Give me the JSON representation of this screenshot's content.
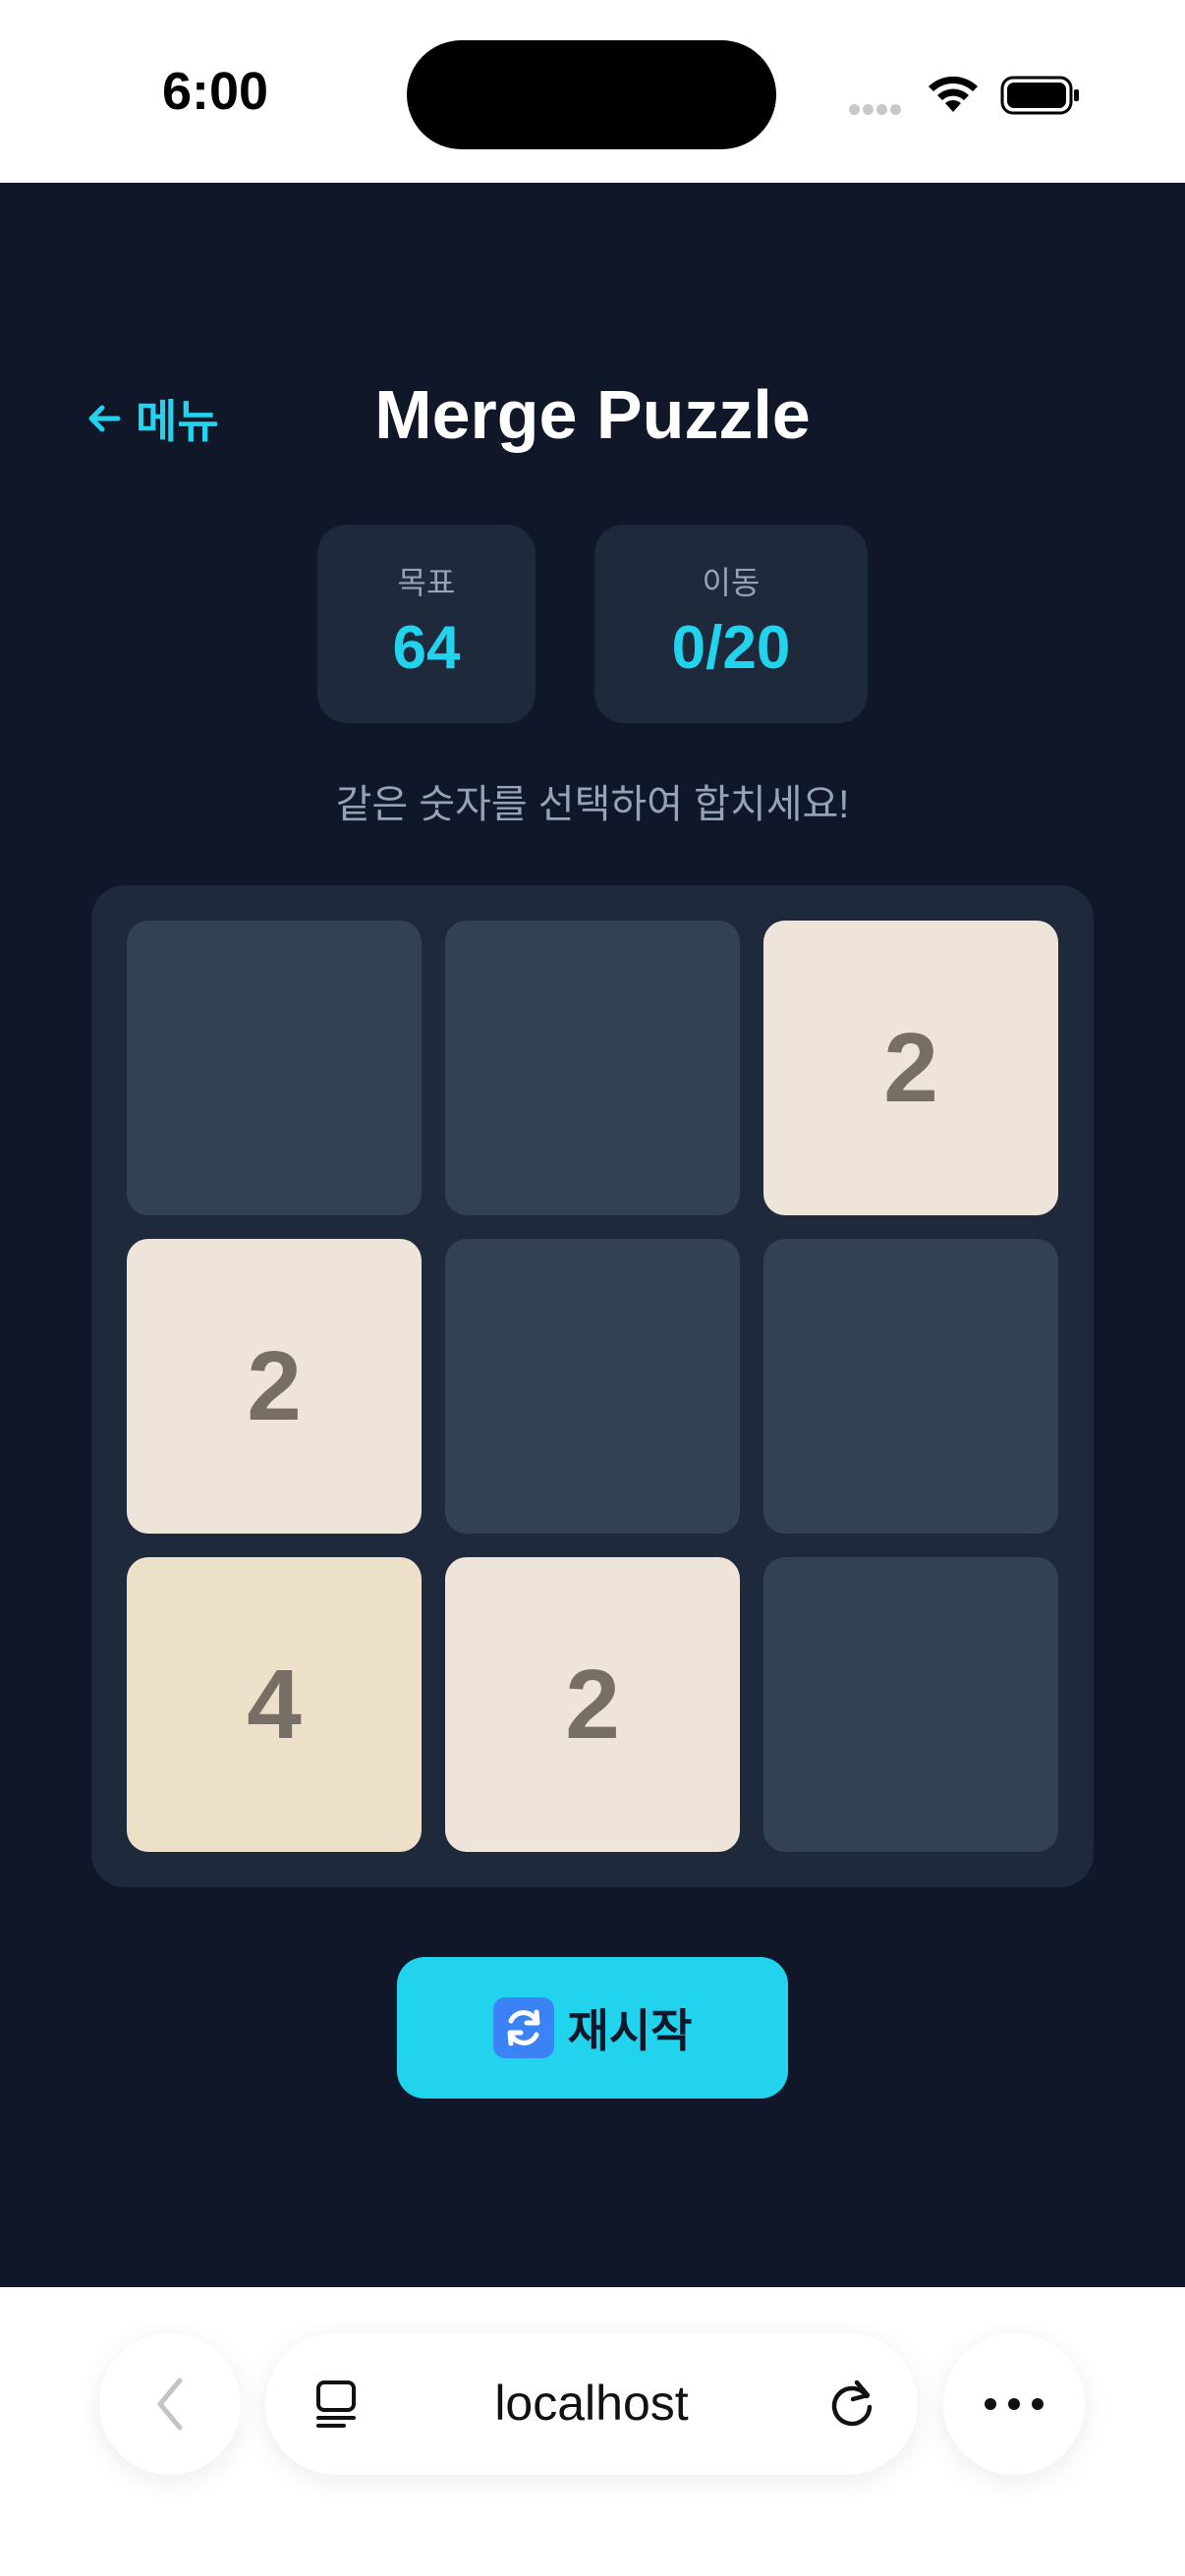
{
  "status_bar": {
    "time": "6:00"
  },
  "header": {
    "back_label": "메뉴",
    "title": "Merge Puzzle"
  },
  "stats": {
    "target_label": "목표",
    "target_value": "64",
    "moves_label": "이동",
    "moves_value": "0/20"
  },
  "instruction": "같은 숫자를 선택하여 합치세요!",
  "board": {
    "rows": [
      [
        "",
        "",
        "2"
      ],
      [
        "2",
        "",
        ""
      ],
      [
        "4",
        "2",
        ""
      ]
    ]
  },
  "restart_label": "재시작",
  "browser": {
    "url": "localhost"
  },
  "colors": {
    "background": "#101729",
    "accent": "#22d3ee",
    "panel": "#1e293b",
    "empty_tile": "#334155",
    "tile_2": "#eee4da",
    "tile_4": "#ede0c8",
    "tile_text": "#776e65"
  },
  "icons": {
    "back": "arrow-left-icon",
    "restart": "refresh-icon",
    "browser_back": "chevron-left-icon",
    "tabs": "tabs-icon",
    "reload": "reload-icon",
    "more": "ellipsis-icon"
  }
}
